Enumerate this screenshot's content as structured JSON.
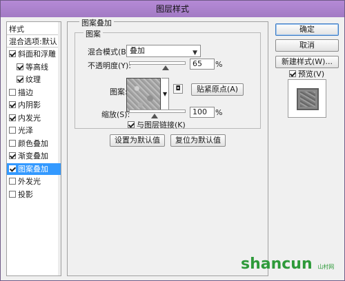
{
  "window": {
    "title": "图层样式"
  },
  "left_panel": {
    "header": "样式",
    "blend_options": "混合选项:默认",
    "items": [
      {
        "label": "斜面和浮雕",
        "checked": true,
        "indent": false
      },
      {
        "label": "等高线",
        "checked": true,
        "indent": true
      },
      {
        "label": "纹理",
        "checked": true,
        "indent": true
      },
      {
        "label": "描边",
        "checked": false,
        "indent": false
      },
      {
        "label": "内阴影",
        "checked": true,
        "indent": false
      },
      {
        "label": "内发光",
        "checked": true,
        "indent": false
      },
      {
        "label": "光泽",
        "checked": false,
        "indent": false
      },
      {
        "label": "颜色叠加",
        "checked": false,
        "indent": false
      },
      {
        "label": "渐变叠加",
        "checked": true,
        "indent": false
      },
      {
        "label": "图案叠加",
        "checked": true,
        "indent": false,
        "selected": true
      },
      {
        "label": "外发光",
        "checked": false,
        "indent": false
      },
      {
        "label": "投影",
        "checked": false,
        "indent": false
      }
    ]
  },
  "main": {
    "section_title": "图案叠加",
    "group_title": "图案",
    "blend_mode_label": "混合模式(B):",
    "blend_mode_value": "叠加",
    "opacity_label": "不透明度(Y):",
    "opacity_value": "65",
    "opacity_level": 0.65,
    "percent": "%",
    "pattern_label": "图案:",
    "snap_origin_button": "贴紧原点(A)",
    "scale_label": "缩放(S):",
    "scale_value": "100",
    "scale_level": 0.45,
    "link_layer_label": "与图层链接(K)",
    "link_layer_checked": true,
    "set_default_button": "设置为默认值",
    "reset_default_button": "复位为默认值"
  },
  "right_panel": {
    "ok_button": "确定",
    "cancel_button": "取消",
    "new_style_button": "新建样式(W)...",
    "preview_label": "预览(V)",
    "preview_checked": true
  },
  "watermark": {
    "text": "shancun",
    "sub": "山村网"
  },
  "colors": {
    "titlebar": "#a27ac4",
    "selected": "#3399ff",
    "watermark": "#2e9a3a"
  }
}
